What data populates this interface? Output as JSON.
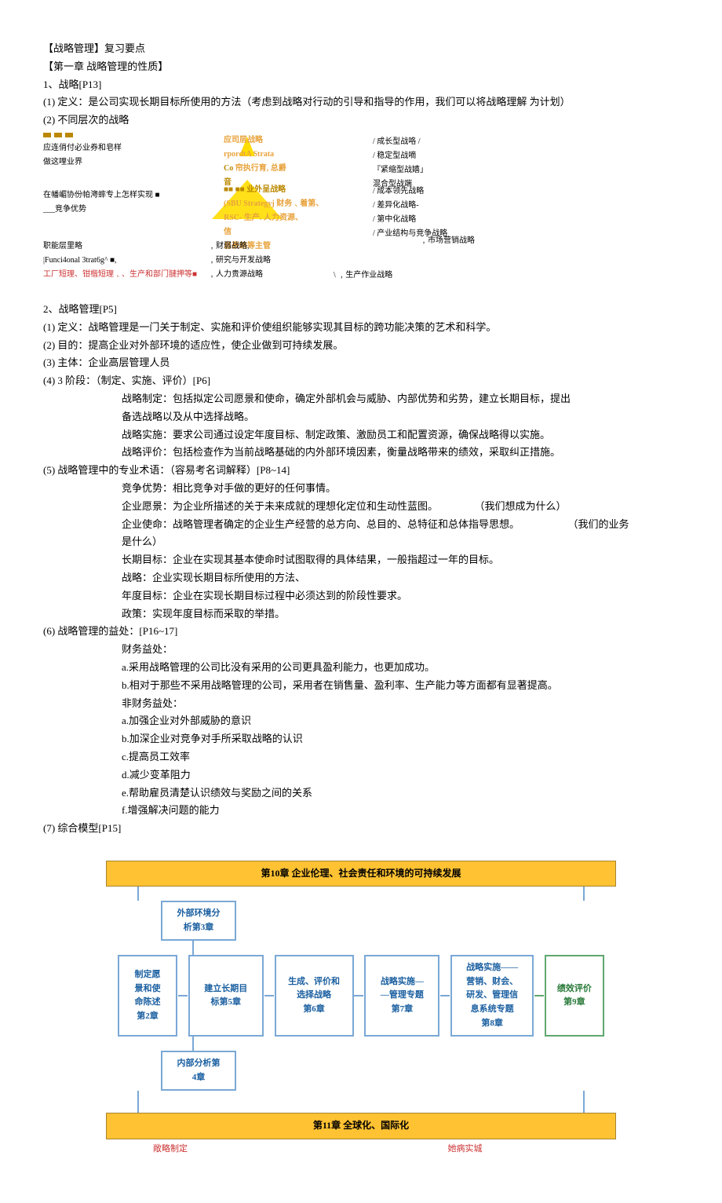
{
  "title": "【战略管理】复习要点",
  "chapter1": "【第一章  战略管理的性质】",
  "h1": "1、战略[P13]",
  "h1_1": "(1)    定义：是公司实现长期目标所使用的方法（考虑到战略对行动的引导和指导的作用，我们可以将战略理解 为计划）",
  "h1_2": "(2)    不同层次的战略",
  "pyramid": {
    "left1": "应连俏付必业券和皂样",
    "left2": "做这哩业界",
    "left3": "在幡嵋协份帕澚蟀专上怎样实现 ■",
    "left4": "___竞争优势",
    "left5": "职能层里略",
    "left6": "|Funci4onal 3trat6g^ ■,",
    "left7": "工厂短理、钳楷短理﹑、生产和部门翴押等■",
    "mid1": "应司层战略",
    "mid2": "rpordtA Strata",
    "mid3": "Co",
    "mid4": "帘执行育, 总爵",
    "mid5": "音",
    "mid6": "■■ ■■  业外呈战略",
    "mid7": "(SBU Strategyj 财务﹑着第、",
    "mid8": "RSC- 生产. 人力资源、",
    "mid9": "信",
    "mid10": "息表统等主管",
    "mid11": "﹐财弱战略,",
    "mid12": "﹐研究与开发战略",
    "mid13": "﹐人力贵源战略",
    "right1": "/ 成长型战咯 /",
    "right2": "/ 稳定型战嘀",
    "right3": "『紧缩型战嬉」",
    "right4": "混合型战端",
    "right5": "/ 成本领先战略",
    "right6": "/ 差异化战略-",
    "right7": "/ 第中化战略",
    "right8": "/ 产业结构与竞争战略",
    "right9": "﹐市场营销战略",
    "right10": "\\    ﹐生产作业战略"
  },
  "h2": "2、战略管理[P5]",
  "h2_1": "(1)    定义：战略管理是一门关于制定、实施和评价使组织能够实现其目标的跨功能决策的艺术和科学。",
  "h2_2": "(2)    目的：提高企业对外部环境的适应性，使企业做到可持续发展。",
  "h2_3": "(3)    主体：企业高层管理人员",
  "h2_4": "(4)    3 阶段：（制定、实施、评价）[P6]",
  "h2_4a": "战略制定：包括拟定公司愿景和使命，确定外部机会与威胁、内部优势和劣势，建立长期目标，提出",
  "h2_4b": "备选战略以及从中选择战略。",
  "h2_4c": "战略实施：要求公司通过设定年度目标、制定政策、激励员工和配置资源，确保战略得以实施。",
  "h2_4d": "战略评价：包括检查作为当前战略基础的内外部环境因素，衡量战略带来的绩效，采取纠正措施。",
  "h2_5": "(5)    战略管理中的专业术语：（容易考名词解释）[P8~14]",
  "h2_5a": "竞争优势：相比竞争对手做的更好的任何事情。",
  "h2_5b": "企业愿景：为企业所描述的关于未来成就的理想化定位和生动性蓝图。",
  "h2_5b2": "（我们想成为什么）",
  "h2_5c": "企业使命：战略管理者确定的企业生产经营的总方向、总目的、总特征和总体指导思想。",
  "h2_5c2": "（我们的业务",
  "h2_5c3": "是什么）",
  "h2_5d": "长期目标：企业在实现其基本使命时试图取得的具体结果，一般指超过一年的目标。",
  "h2_5e": "战略：企业实现长期目标所使用的方法、",
  "h2_5f": "年度目标：企业在实现长期目标过程中必须达到的阶段性要求。",
  "h2_5g": "政策：实现年度目标而采取的举措。",
  "h2_6": "(6)    战略管理的益处：[P16~17]",
  "h2_6a": "财务益处：",
  "h2_6a1": "a.采用战略管理的公司比没有采用的公司更具盈利能力，也更加成功。",
  "h2_6a2": "b.相对于那些不采用战略管理的公司，采用者在销售量、盈利率、生产能力等方面都有显著提高。",
  "h2_6b": "非财务益处：",
  "h2_6b1": "a.加强企业对外部威胁的意识",
  "h2_6b2": "b.加深企业对竞争对手所采取战略的认识",
  "h2_6b3": "c.提高员工效率",
  "h2_6b4": "d.减少变革阻力",
  "h2_6b5": "e.帮助雇员清楚认识绩效与奖励之间的关系",
  "h2_6b6": "f.增强解决问题的能力",
  "h2_7": "(7)    综合模型[P15]",
  "flowchart": {
    "top": "第10章 企业伦理、社会责任和环境的可持续发展",
    "box1a": "外部环境分",
    "box1b": "析第3章",
    "box2a": "制定愿",
    "box2b": "景和使",
    "box2c": "命陈述",
    "box2d": "第2章",
    "box3a": "建立长期目",
    "box3b": "标第5章",
    "box4a": "生成、评价和",
    "box4b": "选择战略",
    "box4c": "第6章",
    "box5a": "战略实施—",
    "box5b": "—管理专题",
    "box5c": "第7章",
    "box6a": "战略实施——",
    "box6b": "营销、财会、",
    "box6c": "研发、管理信",
    "box6d": "息系统专题",
    "box6e": "第8章",
    "box7a": "绩效评价",
    "box7b": "第9章",
    "box8a": "内部分析第",
    "box8b": "4章",
    "bottom": "第11章 全球化、国际化",
    "lbl_left": "敞略制定",
    "lbl_right": "她病实城"
  }
}
